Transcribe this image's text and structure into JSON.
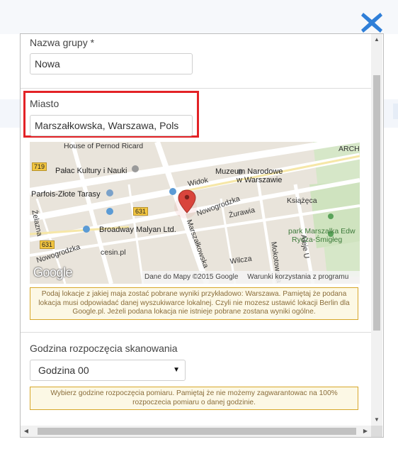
{
  "dialog": {
    "group_name": {
      "label": "Nazwa grupy *",
      "value": "Nowa"
    },
    "city": {
      "label": "Miasto",
      "value": "Marszałkowska, Warszawa, Pols"
    },
    "map": {
      "places": {
        "pernod": "House of Pernod Ricard",
        "archit": "ARCHITE",
        "palac": "Pałac Kultury i Nauki",
        "muzeum1": "Muzeum Narodowe",
        "muzeum2": "w Warszawie",
        "widok": "Widok",
        "parfois": "Parfois-Złote Tarasy",
        "nowogrodzka": "Nowogrodzka",
        "nowogrodzka2": "Nowogrodzka",
        "ksiazeca": "Książęca",
        "zurawia": "Żurawia",
        "marszalkowska": "Marszałkowska",
        "zelazna": "Żelazna",
        "broadway": "Broadway Malyan Ltd.",
        "park1": "park Marszałka Edw",
        "park2": "Rydza-Śmigłeg",
        "cesin": "cesin.pl",
        "wilcza": "Wilcza",
        "mokotowska": "Mokotowska",
        "aleje": "Aleje U",
        "google": "Google"
      },
      "road_badges": {
        "r719": "719",
        "r631a": "631",
        "r631b": "631"
      },
      "credit": {
        "data": "Dane do Mapy ©2015 Google",
        "terms": "Warunki korzystania z programu"
      }
    },
    "city_notice": "Podaj lokacje z jakiej maja zostać pobrane wyniki przykładowo: Warszawa. Pamiętaj że podana lokacja musi odpowiadać danej wyszukiwarce lokalnej. Czyli nie mozesz ustawić lokacji Berlin dla Google.pl. Jeżeli podana lokacja nie istnieje pobrane zostana wyniki ogólne.",
    "scan_start": {
      "label": "Godzina rozpoczęcia skanowania",
      "selected": "Godzina 00",
      "notice": "Wybierz godzine rozpoczęcia pomiaru. Pamiętaj że nie możemy zagwarantowac na 100% rozpoczecia pomiaru o danej godzinie."
    }
  },
  "colors": {
    "close_icon": "#2f7fd8",
    "highlight_border": "#e32226",
    "notice_border": "#d7a72a",
    "notice_bg": "#fcf8e5",
    "map_pin": "#d9453c"
  },
  "icons": {
    "close": "close-icon",
    "map_pin": "map-pin-icon",
    "select_arrow": "▼",
    "scroll_up": "▲",
    "scroll_down": "▼",
    "scroll_left": "◀",
    "scroll_right": "▶"
  }
}
